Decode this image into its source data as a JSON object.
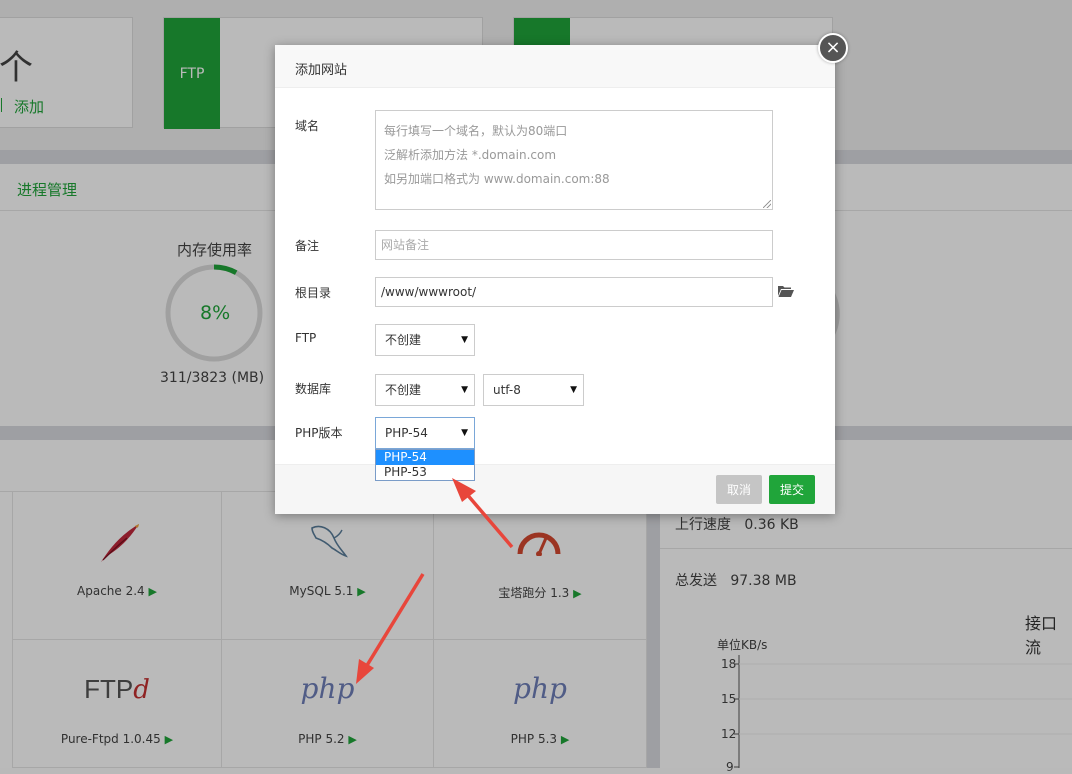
{
  "background": {
    "card1": {
      "count_char": "个",
      "add_link": "添加"
    },
    "card2": {
      "tab_label": "FTP"
    },
    "process": {
      "title": "进程管理"
    },
    "memory": {
      "title": "内存使用率",
      "percent": "8%",
      "usage": "311/3823 (MB)",
      "fraction": 0.08
    },
    "software": [
      {
        "name": "Apache 2.4",
        "icon": "apache-feather-icon"
      },
      {
        "name": "MySQL 5.1",
        "icon": "mysql-dolphin-icon"
      },
      {
        "name": "宝塔跑分 1.3",
        "icon": "speedometer-icon"
      },
      {
        "name": "Pure-Ftpd 1.0.45",
        "icon": "ftpd-logo"
      },
      {
        "name": "PHP 5.2",
        "icon": "php-logo"
      },
      {
        "name": "PHP 5.3",
        "icon": "php-logo"
      }
    ],
    "ftpd_logo": {
      "main": "FTP",
      "accent": "d"
    },
    "php_logo_text": "php",
    "play_glyph": "▶",
    "stats": {
      "upload_label": "上行速度",
      "upload_value": "0.36 KB",
      "sent_label": "总发送",
      "sent_value": "97.38 MB"
    },
    "traffic_chart": {
      "title": "接口流",
      "unit": "单位KB/s",
      "ticks": [
        "18",
        "15",
        "12",
        "9"
      ]
    }
  },
  "modal": {
    "title": "添加网站",
    "close_glyph": "×",
    "domain": {
      "label": "域名",
      "placeholder_lines": [
        "每行填写一个域名，默认为80端口",
        "泛解析添加方法 *.domain.com",
        "如另加端口格式为 www.domain.com:88"
      ]
    },
    "note": {
      "label": "备注",
      "placeholder": "网站备注"
    },
    "root": {
      "label": "根目录",
      "value": "/www/wwwroot/",
      "icon": "folder-open-icon"
    },
    "ftp": {
      "label": "FTP",
      "selected": "不创建"
    },
    "database": {
      "label": "数据库",
      "selected": "不创建",
      "charset": "utf-8"
    },
    "php": {
      "label": "PHP版本",
      "selected": "PHP-54",
      "options": [
        "PHP-54",
        "PHP-53"
      ]
    },
    "caret_glyph": "▼",
    "buttons": {
      "cancel": "取消",
      "submit": "提交"
    }
  },
  "colors": {
    "accent": "#20a53a",
    "select_highlight": "#1e90ff",
    "annotation_arrow": "#e8463b"
  }
}
